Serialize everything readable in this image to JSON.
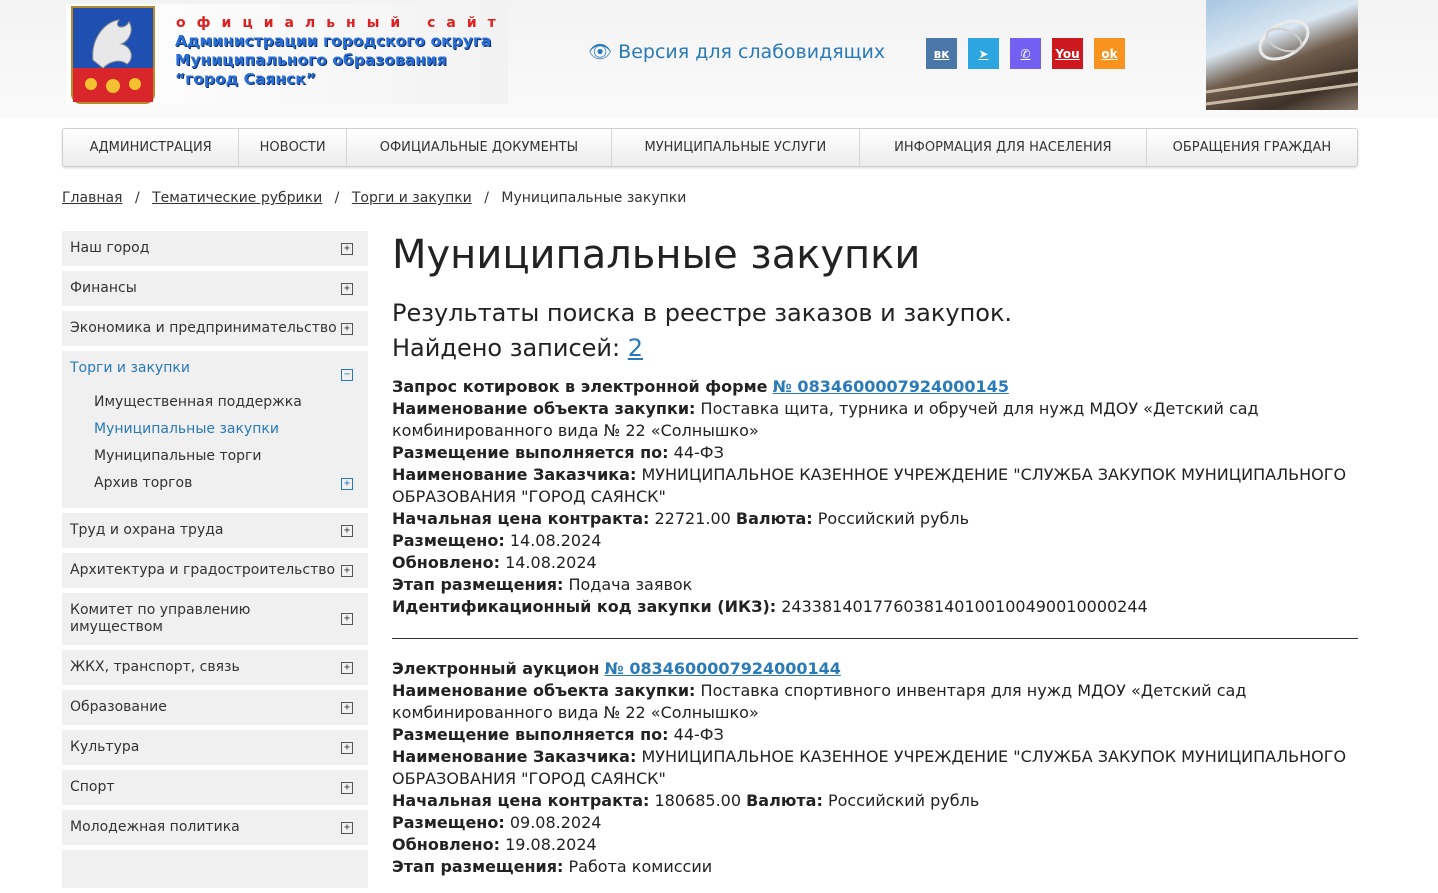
{
  "header": {
    "site_small": "официальный сайт",
    "site_name_1": "Администрации городского округа",
    "site_name_2": "Муниципального образования",
    "site_name_3": "“город Саянск”",
    "vision_icon": "eye-icon",
    "vision_label": "Версия для слабовидящих",
    "socials": [
      {
        "name": "vk-icon",
        "color": "#4a76a8",
        "glyph": "вк"
      },
      {
        "name": "telegram-icon",
        "color": "#2ca5e0",
        "glyph": "➤"
      },
      {
        "name": "viber-icon",
        "color": "#7360f2",
        "glyph": "✆"
      },
      {
        "name": "youtube-icon",
        "color": "#cc181e",
        "glyph": "You"
      },
      {
        "name": "odnoklassniki-icon",
        "color": "#f7931e",
        "glyph": "ok"
      }
    ]
  },
  "nav": [
    "Администрация",
    "Новости",
    "Официальные документы",
    "Муниципальные услуги",
    "Информация для населения",
    "Обращения граждан"
  ],
  "breadcrumbs": {
    "home": "Главная",
    "rubrics": "Тематические рубрики",
    "section": "Торги и закупки",
    "current": "Муниципальные закупки",
    "sep": "/"
  },
  "sidebar": {
    "items": [
      {
        "label": "Наш город"
      },
      {
        "label": "Финансы"
      },
      {
        "label": "Экономика и предпринимательство"
      },
      {
        "label": "Торги и закупки",
        "sub": [
          "Имущественная поддержка",
          "Муниципальные закупки",
          "Муниципальные торги",
          "Архив торгов"
        ]
      },
      {
        "label": "Труд и охрана труда"
      },
      {
        "label": "Архитектура и градостроительство"
      },
      {
        "label": "Комитет по управлению имуществом"
      },
      {
        "label": "ЖКХ, транспорт, связь"
      },
      {
        "label": "Образование"
      },
      {
        "label": "Культура"
      },
      {
        "label": "Спорт"
      },
      {
        "label": "Молодежная политика"
      }
    ]
  },
  "main": {
    "title": "Муниципальные закупки",
    "subtitle": "Результаты поиска в реестре заказов и закупок.",
    "found_label": "Найдено записей:",
    "found_count": "2",
    "labels": {
      "object": "Наименование объекта закупки:",
      "placement": "Размещение выполняется по:",
      "customer": "Наименование Заказчика:",
      "price": "Начальная цена контракта:",
      "currency": "Валюта:",
      "placed": "Размещено:",
      "updated": "Обновлено:",
      "stage": "Этап размещения:",
      "ikz": "Идентификационный код закупки (ИКЗ):"
    },
    "records": [
      {
        "type": "Запрос котировок в электронной форме",
        "number": "№ 0834600007924000145",
        "object": "Поставка щита, турника и обручей для нужд МДОУ «Детский сад комбинированного вида № 22 «Солнышко»",
        "placement": "44-ФЗ",
        "customer": "МУНИЦИПАЛЬНОЕ КАЗЕННОЕ УЧРЕЖДЕНИЕ \"СЛУЖБА ЗАКУПОК МУНИЦИПАЛЬНОГО ОБРАЗОВАНИЯ \"ГОРОД САЯНСК\"",
        "price": "22721.00",
        "currency": "Российский рубль",
        "placed": "14.08.2024",
        "updated": "14.08.2024",
        "stage": "Подача заявок",
        "ikz": "243381401776038140100100490010000244"
      },
      {
        "type": "Электронный аукцион",
        "number": "№ 0834600007924000144",
        "object": "Поставка спортивного инвентаря для нужд МДОУ «Детский сад комбинированного вида № 22 «Солнышко»",
        "placement": "44-ФЗ",
        "customer": "МУНИЦИПАЛЬНОЕ КАЗЕННОЕ УЧРЕЖДЕНИЕ \"СЛУЖБА ЗАКУПОК МУНИЦИПАЛЬНОГО ОБРАЗОВАНИЯ \"ГОРОД САЯНСК\"",
        "price": "180685.00",
        "currency": "Российский рубль",
        "placed": "09.08.2024",
        "updated": "19.08.2024",
        "stage": "Работа комиссии"
      }
    ]
  }
}
